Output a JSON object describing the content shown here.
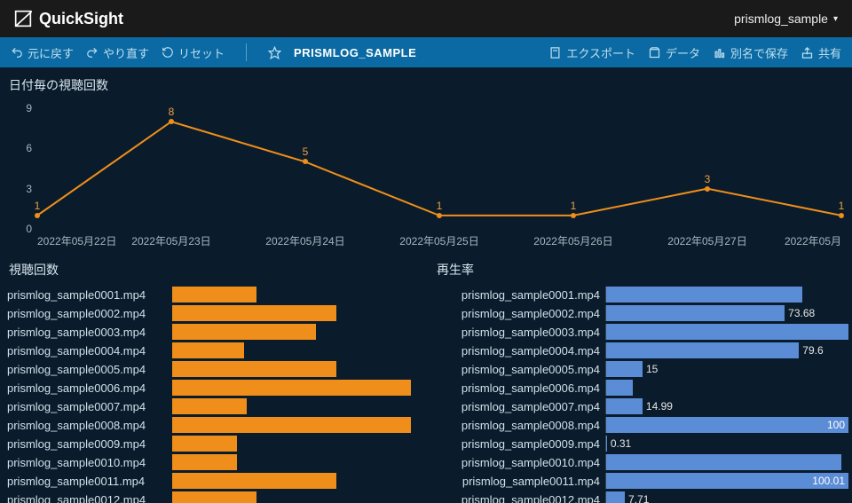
{
  "app": {
    "name": "QuickSight",
    "user": "prismlog_sample"
  },
  "toolbar": {
    "undo": "元に戻す",
    "redo": "やり直す",
    "reset": "リセット",
    "title": "PRISMLOG_SAMPLE",
    "export": "エクスポート",
    "data": "データ",
    "saveas": "別名で保存",
    "share": "共有"
  },
  "chart_data": [
    {
      "type": "line",
      "title": "日付毎の視聴回数",
      "categories": [
        "2022年05月22日",
        "2022年05月23日",
        "2022年05月24日",
        "2022年05月25日",
        "2022年05月26日",
        "2022年05月27日",
        "2022年05月"
      ],
      "values": [
        1,
        8,
        5,
        1,
        1,
        3,
        1
      ],
      "yticks": [
        0,
        3,
        6,
        9
      ],
      "ylim": [
        0,
        9
      ]
    },
    {
      "type": "bar",
      "title": "視聴回数",
      "orientation": "horizontal",
      "color": "#ef8e1b",
      "xlim": [
        0,
        10
      ],
      "categories": [
        "prismlog_sample0001.mp4",
        "prismlog_sample0002.mp4",
        "prismlog_sample0003.mp4",
        "prismlog_sample0004.mp4",
        "prismlog_sample0005.mp4",
        "prismlog_sample0006.mp4",
        "prismlog_sample0007.mp4",
        "prismlog_sample0008.mp4",
        "prismlog_sample0009.mp4",
        "prismlog_sample0010.mp4",
        "prismlog_sample0011.mp4",
        "prismlog_sample0012.mp4"
      ],
      "values": [
        3.4,
        6.6,
        5.8,
        2.9,
        6.6,
        9.6,
        3.0,
        9.6,
        2.6,
        2.6,
        6.6,
        3.4
      ],
      "show_value_labels": false
    },
    {
      "type": "bar",
      "title": "再生率",
      "orientation": "horizontal",
      "color": "#5b8dd6",
      "xlim": [
        0,
        100
      ],
      "categories": [
        "prismlog_sample0001.mp4",
        "prismlog_sample0002.mp4",
        "prismlog_sample0003.mp4",
        "prismlog_sample0004.mp4",
        "prismlog_sample0005.mp4",
        "prismlog_sample0006.mp4",
        "prismlog_sample0007.mp4",
        "prismlog_sample0008.mp4",
        "prismlog_sample0009.mp4",
        "prismlog_sample0010.mp4",
        "prismlog_sample0011.mp4",
        "prismlog_sample0012.mp4"
      ],
      "values": [
        81,
        73.68,
        100,
        79.6,
        15,
        11,
        14.99,
        100,
        0.31,
        97,
        100.01,
        7.71
      ],
      "value_labels": {
        "1": "73.68",
        "3": "79.6",
        "4": "15",
        "6": "14.99",
        "7": "100",
        "8": "0.31",
        "10": "100.01",
        "11": "7.71"
      }
    }
  ]
}
